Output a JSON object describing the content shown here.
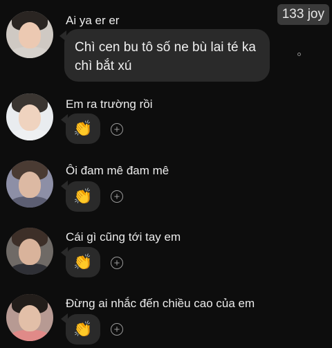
{
  "badge": {
    "text": "133 joy"
  },
  "messages": [
    {
      "sender": "Ai ya er er",
      "text": "Chì cen bu tô số ne bù lai té ka chì bắt xú"
    },
    {
      "sender": "Em ra trường rồi",
      "reaction": "👏",
      "add_reaction": "+"
    },
    {
      "sender": "Ôi đam mê đam mê",
      "reaction": "👏",
      "add_reaction": "+"
    },
    {
      "sender": "Cái gì cũng tới tay em",
      "reaction": "👏",
      "add_reaction": "+"
    },
    {
      "sender": "Đừng ai nhắc đến chiều cao của em",
      "reaction": "👏",
      "add_reaction": "+"
    }
  ],
  "colors": {
    "background": "#0d0d0d",
    "bubble": "#2a2a2a",
    "badge_bg": "#3a3a3a",
    "text": "#e8e8e8"
  }
}
